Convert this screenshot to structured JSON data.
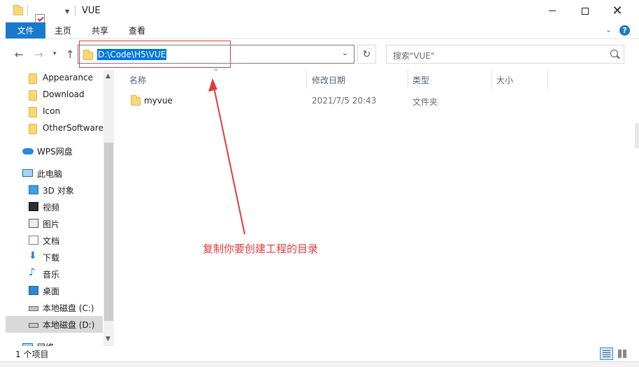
{
  "window": {
    "title": "VUE"
  },
  "ribbon": {
    "file_tab": "文件",
    "tabs": [
      "主页",
      "共享",
      "查看"
    ]
  },
  "address": {
    "path": "D:\\Code\\H5\\VUE"
  },
  "search": {
    "placeholder": "搜索\"VUE\""
  },
  "sidebar": {
    "quick_access": [
      "Appearance",
      "Download",
      "Icon",
      "OtherSoftware"
    ],
    "wps": "WPS网盘",
    "this_pc": "此电脑",
    "pc_items": [
      "3D 对象",
      "视频",
      "图片",
      "文档",
      "下载",
      "音乐",
      "桌面",
      "本地磁盘 (C:)",
      "本地磁盘 (D:)"
    ],
    "network": "网络"
  },
  "columns": [
    "名称",
    "修改日期",
    "类型",
    "大小"
  ],
  "rows": [
    {
      "name": "myvue",
      "modified": "2021/7/5 20:43",
      "type": "文件夹",
      "size": ""
    }
  ],
  "annotation": "复制你要创建工程的目录",
  "status": {
    "item_count": "1 个项目"
  },
  "colors": {
    "accent": "#1979ca",
    "selection": "#0078d7",
    "annotation": "#e03b3b"
  }
}
